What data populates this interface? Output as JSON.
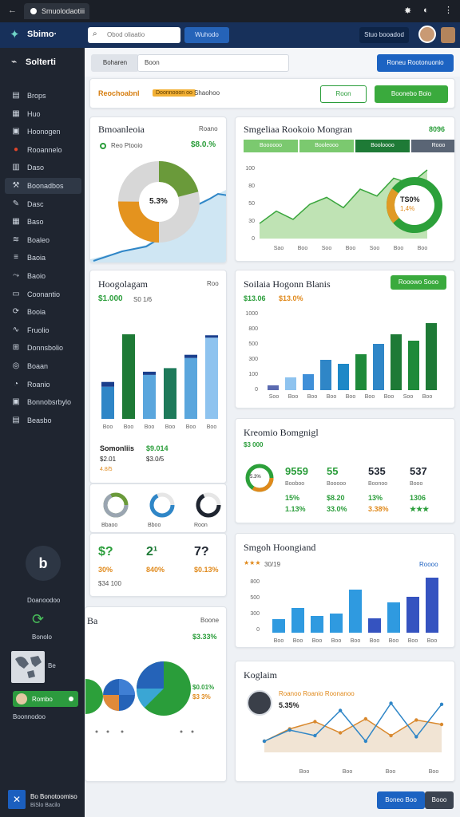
{
  "browser": {
    "tab_title": "Smuolodaotiii"
  },
  "header": {
    "brand": "Sbimo·",
    "search_placeholder": "Obod oliaatio",
    "action_label": "Wuhodo",
    "account_label": "Stuo booadod"
  },
  "sidebar": {
    "title": "Solterti",
    "items": [
      {
        "label": "Brops",
        "icon": "doc-icon"
      },
      {
        "label": "Huo",
        "icon": "table-icon"
      },
      {
        "label": "Hoonogen",
        "icon": "calendar-icon"
      },
      {
        "label": "Rooannelo",
        "icon": "alert-icon"
      },
      {
        "label": "Daso",
        "icon": "chart-icon"
      },
      {
        "label": "Boonadbos",
        "icon": "tools-icon"
      },
      {
        "label": "Dasc",
        "icon": "edit-icon"
      },
      {
        "label": "Baso",
        "icon": "grid-icon"
      },
      {
        "label": "Boaleo",
        "icon": "layers-icon"
      },
      {
        "label": "Baoia",
        "icon": "list-icon"
      },
      {
        "label": "Baoio",
        "icon": "merge-icon"
      },
      {
        "label": "Coonantio",
        "icon": "stack-icon"
      },
      {
        "label": "Booia",
        "icon": "sync-icon"
      },
      {
        "label": "Fruolio",
        "icon": "wave-icon"
      },
      {
        "label": "Donnsbolio",
        "icon": "tag-icon"
      },
      {
        "label": "Boaan",
        "icon": "target-icon"
      },
      {
        "label": "Roanio",
        "icon": "pie-icon"
      },
      {
        "label": "Bonnobsrbylo",
        "icon": "folder-icon"
      },
      {
        "label": "Beasbo",
        "icon": "box-icon"
      }
    ],
    "profile_label": "Doanoodoo",
    "badge_label": "Bonolo",
    "map_label": "Be",
    "toggle_label": "Rombo",
    "footer_label": "Boonnodoo",
    "bottom_label": "Bo Bonotoomiso",
    "bottom_sub": "BiSlo Bacilo"
  },
  "filters": {
    "tab": "Boharen",
    "input": "Boon",
    "action": "Roneu Rootonuonio"
  },
  "toolbar": {
    "label": "Reochoabnl",
    "chip": "Doonnooon oo",
    "sub": "Shaohoo",
    "btn1": "Roon",
    "btn2": "Boonebo Boio"
  },
  "cards": {
    "c1": {
      "title": "Bmoanleoia",
      "side": "Roano",
      "legend": "Reo Ptooio",
      "value": "$8.0.%",
      "donut": "5.3%"
    },
    "c2": {
      "title": "Smgeliaa Rookoio Mongran",
      "value": "8096",
      "tabs": [
        "Boooooo",
        "Booleooo",
        "Booloooo",
        "Rooo"
      ],
      "donut_a": "TS0%",
      "donut_b": "1,4%",
      "yticks": [
        "100",
        "80",
        "50",
        "30",
        "0"
      ],
      "xticks": [
        "Sao",
        "Boo",
        "Soo",
        "Boo",
        "Soo",
        "Boo",
        "Boo"
      ]
    },
    "c3": {
      "title": "Hoogolagam",
      "side": "Roo",
      "v1": "$1.000",
      "v2": "S0 1/6",
      "xticks": [
        "Boo",
        "Boo",
        "Boo",
        "Boo",
        "Boo",
        "Boo",
        "Boo"
      ]
    },
    "c4": {
      "title": "Soilaia Hogonn Blanis",
      "btn": "Rooowo Sooo",
      "v1": "$13.06",
      "v2": "$13.0%",
      "yticks": [
        "1000",
        "800",
        "500",
        "300",
        "100",
        "0"
      ],
      "xticks": [
        "Soo",
        "Boo",
        "Boo",
        "Boo",
        "Boo",
        "Boo",
        "Boo",
        "Soo",
        "Boo"
      ]
    },
    "c5": {
      "stats": [
        {
          "a": "Somonliis",
          "b": "$2.01"
        },
        {
          "a": "$9.014",
          "b": "$3.0/5"
        }
      ],
      "rating": "4.8/5",
      "rings": [
        "Bbaoo",
        "Bboo",
        "Roon"
      ]
    },
    "c6": {
      "title": "Kreomio Bomgnigl",
      "value": "$3 000",
      "donut": "5.3%",
      "cols": [
        {
          "h": "9559",
          "sub": "Booboo",
          "a": "15%",
          "b": "1.13%"
        },
        {
          "h": "55",
          "sub": "Booooo",
          "a": "$8.20",
          "b": "33.0%"
        },
        {
          "h": "535",
          "sub": "Boonoo",
          "a": "13%",
          "b": "3.38%"
        },
        {
          "h": "537",
          "sub": "Booo",
          "a": "1306",
          "b": "★★★"
        }
      ]
    },
    "c7": {
      "items": [
        {
          "v": "$?",
          "p": "30%"
        },
        {
          "v": "2¹",
          "p": "840%"
        },
        {
          "v": "7?",
          "p": "$0.13%"
        }
      ],
      "sub": "$34 100"
    },
    "c8": {
      "title": "Smgoh Hoongiand",
      "rating": "★★★",
      "value": "30/19",
      "link": "Roooo",
      "yticks": [
        "800",
        "500",
        "300",
        "0"
      ],
      "xticks": [
        "Boo",
        "Boo",
        "Boo",
        "Boo",
        "Boo",
        "Boo",
        "Boo",
        "Boo",
        "Boo"
      ]
    },
    "c9": {
      "title": "Ba",
      "side": "Boone",
      "value": "$3.33%",
      "legend1": "$0.01%",
      "legend2": "$3 3%"
    },
    "c10": {
      "title": "Koglaim",
      "name": "Roanoo Roanio Roonanoo",
      "value": "5.35%",
      "xticks": [
        "Boo",
        "Boo",
        "Boo",
        "Boo"
      ]
    }
  },
  "footer": {
    "primary": "Boneo Boo",
    "secondary": "Booo"
  },
  "chart_data": [
    {
      "type": "bar",
      "title": "Hoogolagam",
      "values": [
        38,
        100,
        52,
        60,
        72,
        96
      ],
      "values_b": [
        6,
        0,
        4,
        0,
        4,
        3
      ]
    },
    {
      "type": "bar",
      "title": "Soilaia Hogonn Blanis",
      "values": [
        60,
        160,
        200,
        380,
        330,
        450,
        580,
        700,
        620,
        840
      ],
      "ylim": [
        0,
        1000
      ]
    },
    {
      "type": "bar",
      "title": "Smgoh Hoongiand",
      "values": [
        170,
        310,
        210,
        240,
        540,
        180,
        380,
        450,
        690
      ],
      "ylim": [
        0,
        800
      ]
    },
    {
      "type": "line",
      "title": "Smgeliaa Rookoio Mongran",
      "values": [
        22,
        40,
        28,
        50,
        60,
        45,
        72,
        62,
        88,
        80,
        100
      ],
      "ylim": [
        0,
        100
      ]
    },
    {
      "type": "line",
      "title": "Koglaim",
      "values": [
        20,
        40,
        30,
        75,
        20,
        88,
        28,
        86
      ],
      "values_b": [
        20,
        42,
        55,
        35,
        60,
        30,
        58,
        50
      ]
    }
  ]
}
